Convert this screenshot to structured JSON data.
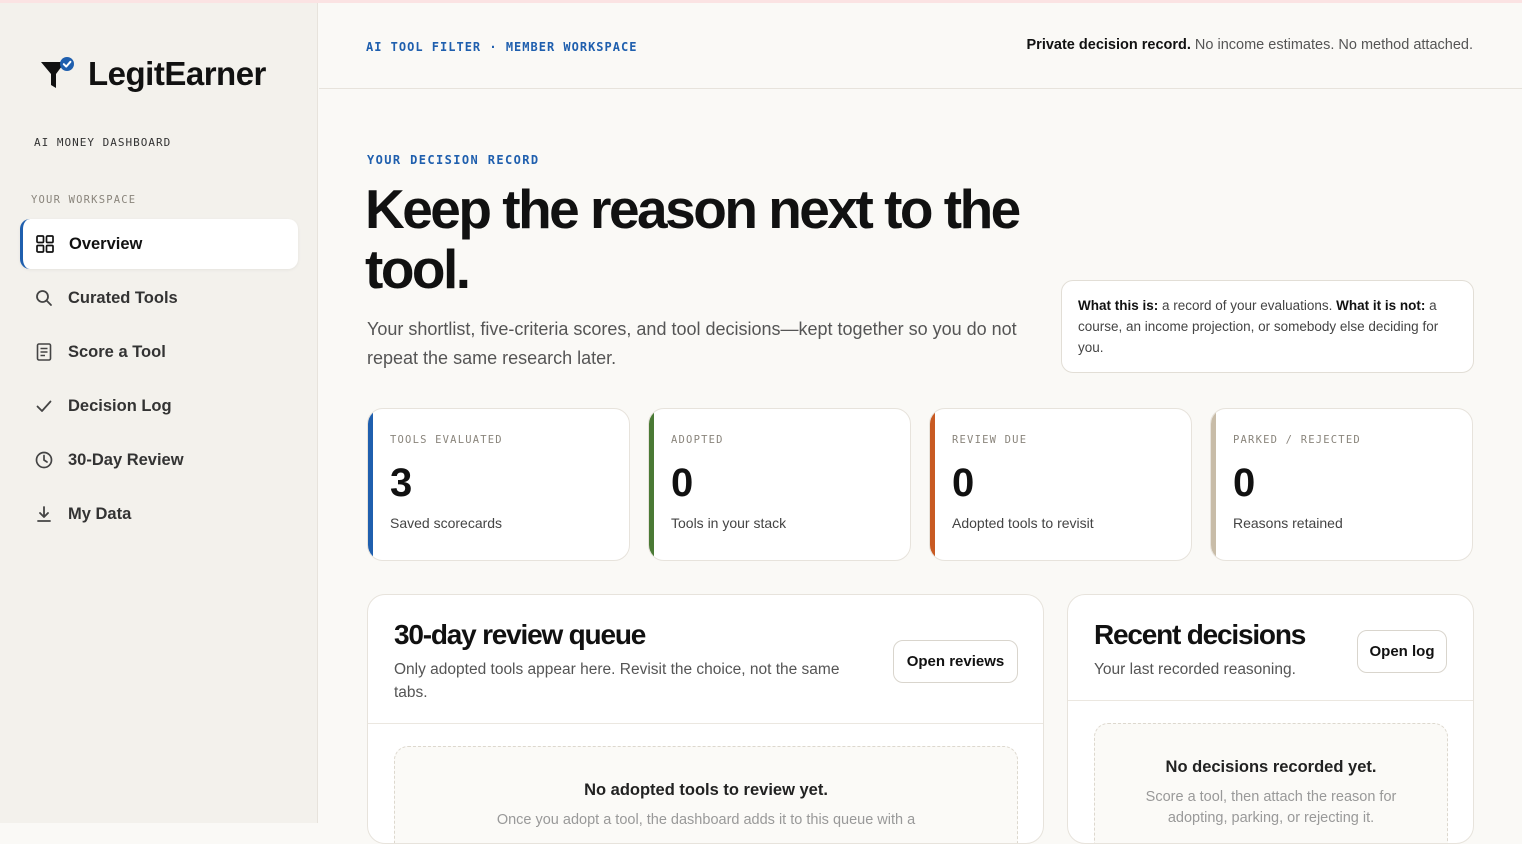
{
  "app": {
    "name": "LegitEarner",
    "subtitle": "AI MONEY DASHBOARD"
  },
  "sidebar": {
    "section_label": "YOUR WORKSPACE",
    "items": [
      {
        "label": "Overview",
        "icon": "grid-icon",
        "active": true
      },
      {
        "label": "Curated Tools",
        "icon": "search-icon"
      },
      {
        "label": "Score a Tool",
        "icon": "document-icon"
      },
      {
        "label": "Decision Log",
        "icon": "check-icon"
      },
      {
        "label": "30-Day Review",
        "icon": "clock-icon"
      },
      {
        "label": "My Data",
        "icon": "download-icon"
      }
    ]
  },
  "header": {
    "breadcrumb": "AI TOOL FILTER · MEMBER WORKSPACE",
    "notice_strong": "Private decision record.",
    "notice_text": " No income estimates. No method attached."
  },
  "hero": {
    "kicker": "YOUR DECISION RECORD",
    "title": "Keep the reason next to the tool.",
    "lead": "Your shortlist, five-criteria scores, and tool decisions—kept together so you do not repeat the same research later.",
    "what_is_label": "What this is:",
    "what_is_text": " a record of your evaluations. ",
    "what_not_label": "What it is not:",
    "what_not_text": " a course, an income projection, or somebody else deciding for you."
  },
  "stats": [
    {
      "label": "TOOLS EVALUATED",
      "value": "3",
      "sub": "Saved scorecards",
      "color": "#1f5fae"
    },
    {
      "label": "ADOPTED",
      "value": "0",
      "sub": "Tools in your stack",
      "color": "#4a7a35"
    },
    {
      "label": "REVIEW DUE",
      "value": "0",
      "sub": "Adopted tools to revisit",
      "color": "#c85a22"
    },
    {
      "label": "PARKED / REJECTED",
      "value": "0",
      "sub": "Reasons retained",
      "color": "#c8bca8"
    }
  ],
  "review_queue": {
    "title": "30-day review queue",
    "desc": "Only adopted tools appear here. Revisit the choice, not the same tabs.",
    "button": "Open reviews",
    "empty_title": "No adopted tools to review yet.",
    "empty_text": "Once you adopt a tool, the dashboard adds it to this queue with a"
  },
  "recent": {
    "title": "Recent decisions",
    "desc": "Your last recorded reasoning.",
    "button": "Open log",
    "empty_title": "No decisions recorded yet.",
    "empty_text": "Score a tool, then attach the reason for adopting, parking, or rejecting it."
  }
}
